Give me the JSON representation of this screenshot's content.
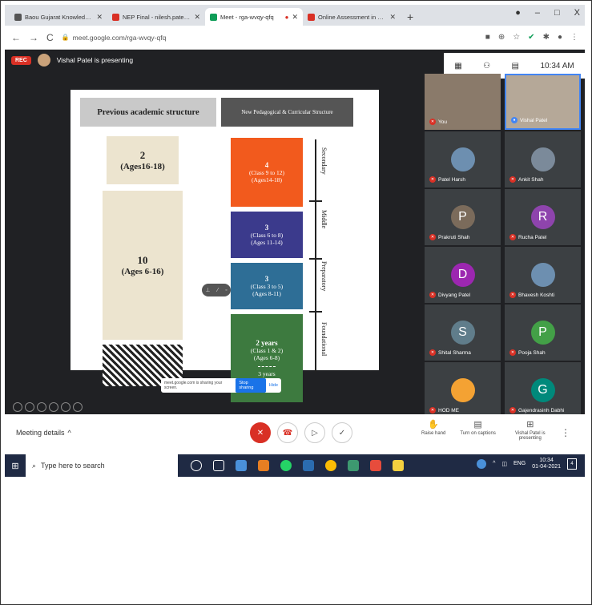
{
  "browser": {
    "tabs": [
      {
        "title": "Baou Gujarat Knowledge Village",
        "color": "#555555"
      },
      {
        "title": "NEP Final - nilesh.patel@baougu",
        "color": "#d93025"
      },
      {
        "title": "Meet - rga-wvqy-qfq",
        "color": "#0f9d58",
        "active": true
      },
      {
        "title": "Online Assessment in DIPLOMA",
        "color": "#d93025"
      }
    ],
    "new_tab": "+",
    "url": "meet.google.com/rga-wvqy-qfq",
    "window_controls": [
      "–",
      "□",
      "X"
    ]
  },
  "meet": {
    "rec_label": "REC",
    "presenting_text": "Vishal Patel is presenting",
    "clock": "10:34 AM",
    "slide": {
      "left_header": "Previous academic structure",
      "right_header": "New Pedagogical & Curricular Structure",
      "left_blocks": [
        {
          "num": "2",
          "ages": "(Ages16-18)"
        },
        {
          "num": "10",
          "ages": "(Ages 6-16)"
        }
      ],
      "right_blocks": [
        {
          "num": "4",
          "classes": "(Class 9 to 12)",
          "ages": "(Ages14-18)",
          "color": "#f25a1d"
        },
        {
          "num": "3",
          "classes": "(Class 6 to 8)",
          "ages": "(Ages 11-14)",
          "color": "#3b3a8c"
        },
        {
          "num": "3",
          "classes": "(Class 3 to 5)",
          "ages": "(Ages 8-11)",
          "color": "#2e6e96"
        },
        {
          "num": "2 years",
          "classes": "(Class 1 & 2)",
          "ages": "(Ages 6-8)",
          "extra": "3 years",
          "color": "#3d7a3f"
        }
      ],
      "stages": [
        "Secondary",
        "Middle",
        "Preparatory",
        "Foundational"
      ]
    },
    "share_banner": {
      "text": "meet.google.com is sharing your screen.",
      "stop_label": "Stop sharing",
      "hide_label": "Hide"
    },
    "participants": [
      {
        "name": "You",
        "initial": "",
        "color": "#8a7a6a",
        "video": true
      },
      {
        "name": "Vishal Patel",
        "initial": "",
        "color": "#b5a898",
        "video": true
      },
      {
        "name": "Patel Harsh",
        "initial": "",
        "color": "#6d8fb0"
      },
      {
        "name": "Ankit Shah",
        "initial": "",
        "color": "#7b8a9a"
      },
      {
        "name": "Prakruti Shah",
        "initial": "P",
        "color": "#7b6b5b"
      },
      {
        "name": "Rucha Patel",
        "initial": "R",
        "color": "#8e44ad"
      },
      {
        "name": "Divyang Patel",
        "initial": "D",
        "color": "#9c27b0"
      },
      {
        "name": "Bhavesh Koshti",
        "initial": "",
        "color": "#6d8fb0"
      },
      {
        "name": "Shital Sharma",
        "initial": "S",
        "color": "#607d8b"
      },
      {
        "name": "Pooja Shah",
        "initial": "P",
        "color": "#43a047"
      },
      {
        "name": "HOD ME",
        "initial": "",
        "color": "#f4a233"
      },
      {
        "name": "Gajendrasinh Dabhi",
        "initial": "G",
        "color": "#00897b"
      }
    ]
  },
  "controls": {
    "meeting_details": "Meeting details",
    "raise_hand": "Raise hand",
    "captions": "Turn on captions",
    "presenting_label": "Vishal Patel is presenting"
  },
  "taskbar": {
    "search_placeholder": "Type here to search",
    "lang": "ENG",
    "time": "10:34",
    "date": "01-04-2021",
    "notif_count": "4"
  }
}
